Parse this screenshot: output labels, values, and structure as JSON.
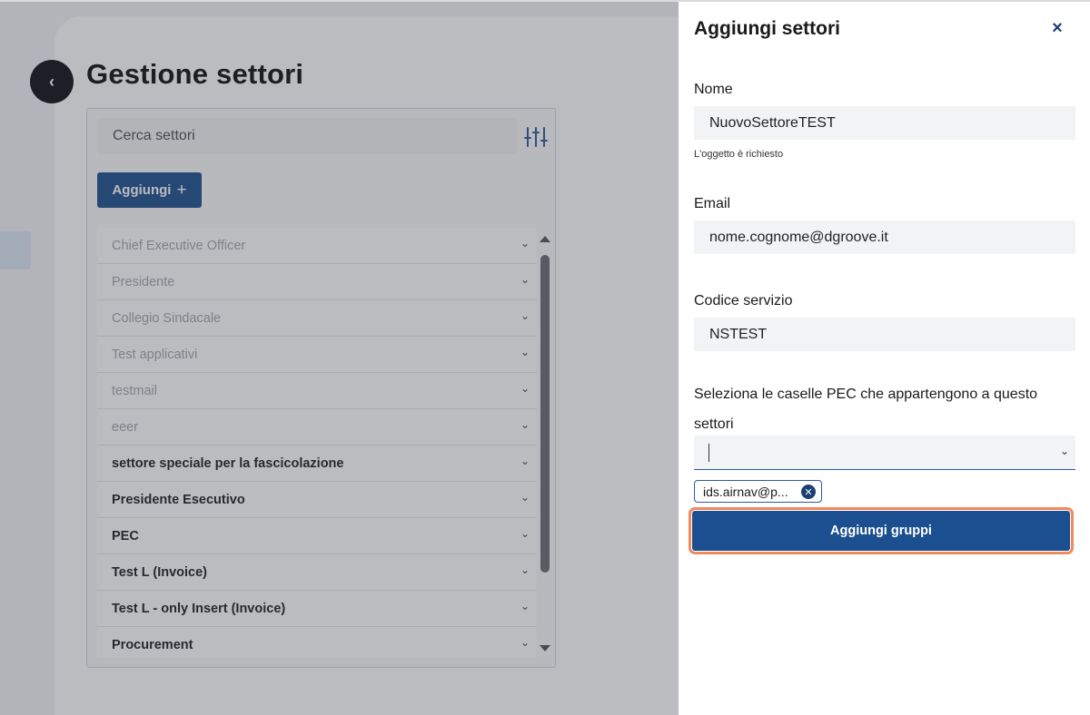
{
  "page": {
    "title": "Gestione settori",
    "back_icon": "chevron-left-icon"
  },
  "search": {
    "placeholder": "Cerca settori",
    "filter_icon": "sliders-icon"
  },
  "add_button": {
    "label": "Aggiungi",
    "icon": "+"
  },
  "sectors": [
    {
      "label": "Chief Executive Officer",
      "enabled": false
    },
    {
      "label": "Presidente",
      "enabled": false
    },
    {
      "label": "Collegio Sindacale",
      "enabled": false
    },
    {
      "label": "Test applicativi",
      "enabled": false
    },
    {
      "label": "testmail",
      "enabled": false
    },
    {
      "label": "eeer",
      "enabled": false
    },
    {
      "label": "settore speciale per la fascicolazione",
      "enabled": true
    },
    {
      "label": "Presidente Esecutivo",
      "enabled": true
    },
    {
      "label": "PEC",
      "enabled": true
    },
    {
      "label": "Test L (Invoice)",
      "enabled": true
    },
    {
      "label": "Test L - only Insert (Invoice)",
      "enabled": true
    },
    {
      "label": "Procurement",
      "enabled": true
    }
  ],
  "drawer": {
    "title": "Aggiungi settori",
    "close_icon": "×",
    "fields": {
      "nome": {
        "label": "Nome",
        "value": "NuovoSettoreTEST",
        "helper": "L'oggetto è richiesto"
      },
      "email": {
        "label": "Email",
        "value": "nome.cognome@dgroove.it"
      },
      "codice": {
        "label": "Codice servizio",
        "value": "NSTEST"
      }
    },
    "pec": {
      "label": "Seleziona le caselle PEC che appartengono a questo settori",
      "selected_chip": "ids.airnav@p...",
      "chip_remove_icon": "✕"
    },
    "submit_label": "Aggiungi gruppi"
  },
  "colors": {
    "primary": "#1c4f8f",
    "focus_ring": "#f08a5d",
    "overlay": "rgba(55,58,66,0.34)"
  }
}
